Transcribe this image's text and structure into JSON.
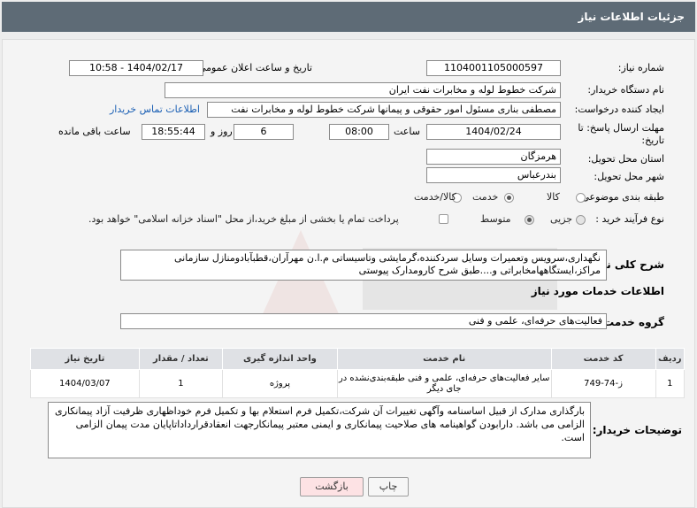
{
  "header": {
    "title": "جزئیات اطلاعات نیاز"
  },
  "form": {
    "need_number": {
      "label": "شماره نیاز:",
      "value": "1104001105000597"
    },
    "announce": {
      "label": "تاریخ و ساعت اعلان عمومی:",
      "value": "1404/02/17 - 10:58"
    },
    "buyer_org": {
      "label": "نام دستگاه خریدار:",
      "value": "شرکت خطوط لوله و مخابرات نفت ایران"
    },
    "creator": {
      "label": "ایجاد کننده درخواست:",
      "value": "مصطفی بناری مسئول امور حقوقی و پیمانها  شرکت خطوط لوله و مخابرات نفت",
      "contact_link": "اطلاعات تماس خریدار"
    },
    "deadline": {
      "label": "مهلت ارسال پاسخ: تا تاریخ:",
      "date": "1404/02/24",
      "time_label": "ساعت",
      "time": "08:00",
      "days": "6",
      "days_label": "روز و",
      "remaining": "18:55:44",
      "remaining_label": "ساعت باقی مانده"
    },
    "province": {
      "label": "استان محل تحویل:",
      "value": "هرمزگان"
    },
    "city": {
      "label": "شهر محل تحویل:",
      "value": "بندرعباس"
    },
    "category": {
      "label": "طبقه بندی موضوعی:",
      "options": [
        "کالا",
        "خدمت",
        "کالا/خدمت"
      ],
      "selected": "خدمت"
    },
    "process": {
      "label": "نوع فرآیند خرید :",
      "options": [
        "جزیی",
        "متوسط"
      ],
      "selected": "متوسط",
      "note": "پرداخت تمام یا بخشی از مبلغ خرید،از محل \"اسناد خزانه اسلامی\" خواهد بود."
    }
  },
  "summary": {
    "label": "شرح کلی نیاز:",
    "text": "نگهداری،سرویس وتعمیرات وسایل سردکننده،گرمایشی وتاسیساتی م.ا.ن مهرآران،قطبآبادومنازل سازمانی مراکز،ایستگاههامخابراتی و....طبق شرح کارومدارک پیوستی"
  },
  "services": {
    "section_title": "اطلاعات خدمات مورد نیاز",
    "group_label": "گروه خدمت:",
    "group_value": "فعالیت‌های حرفه‌ای، علمی و فنی",
    "columns": [
      "ردیف",
      "کد خدمت",
      "نام خدمت",
      "واحد اندازه گیری",
      "تعداد / مقدار",
      "تاریخ نیاز"
    ],
    "rows": [
      {
        "row": "1",
        "code": "ز-74-749",
        "name": "سایر فعالیت‌های حرفه‌ای، علمی و فنی طبقه‌بندی‌نشده در جای دیگر",
        "unit": "پروژه",
        "qty": "1",
        "date": "1404/03/07"
      }
    ]
  },
  "buyer_notes": {
    "label": "توضیحات خریدار:",
    "text": "بارگذاری مدارک از قبیل اساسنامه وآگهی تغییرات  آن شرکت،تکمیل فرم استعلام بها و تکمیل فرم خوداظهاری ظرفیت آزاد پیمانکاری الزامی می باشد. دارابودن گواهینامه های صلاحیت پیمانکاری و ایمنی معتبر پیمانکارجهت انعقادقرارداداتاپایان مدت پیمان الزامی است."
  },
  "buttons": {
    "print": "چاپ",
    "back": "بازگشت"
  },
  "colors": {
    "header_bg": "#5e6b76",
    "back_button_bg": "#fde2e4",
    "link": "#1a5fb4"
  }
}
